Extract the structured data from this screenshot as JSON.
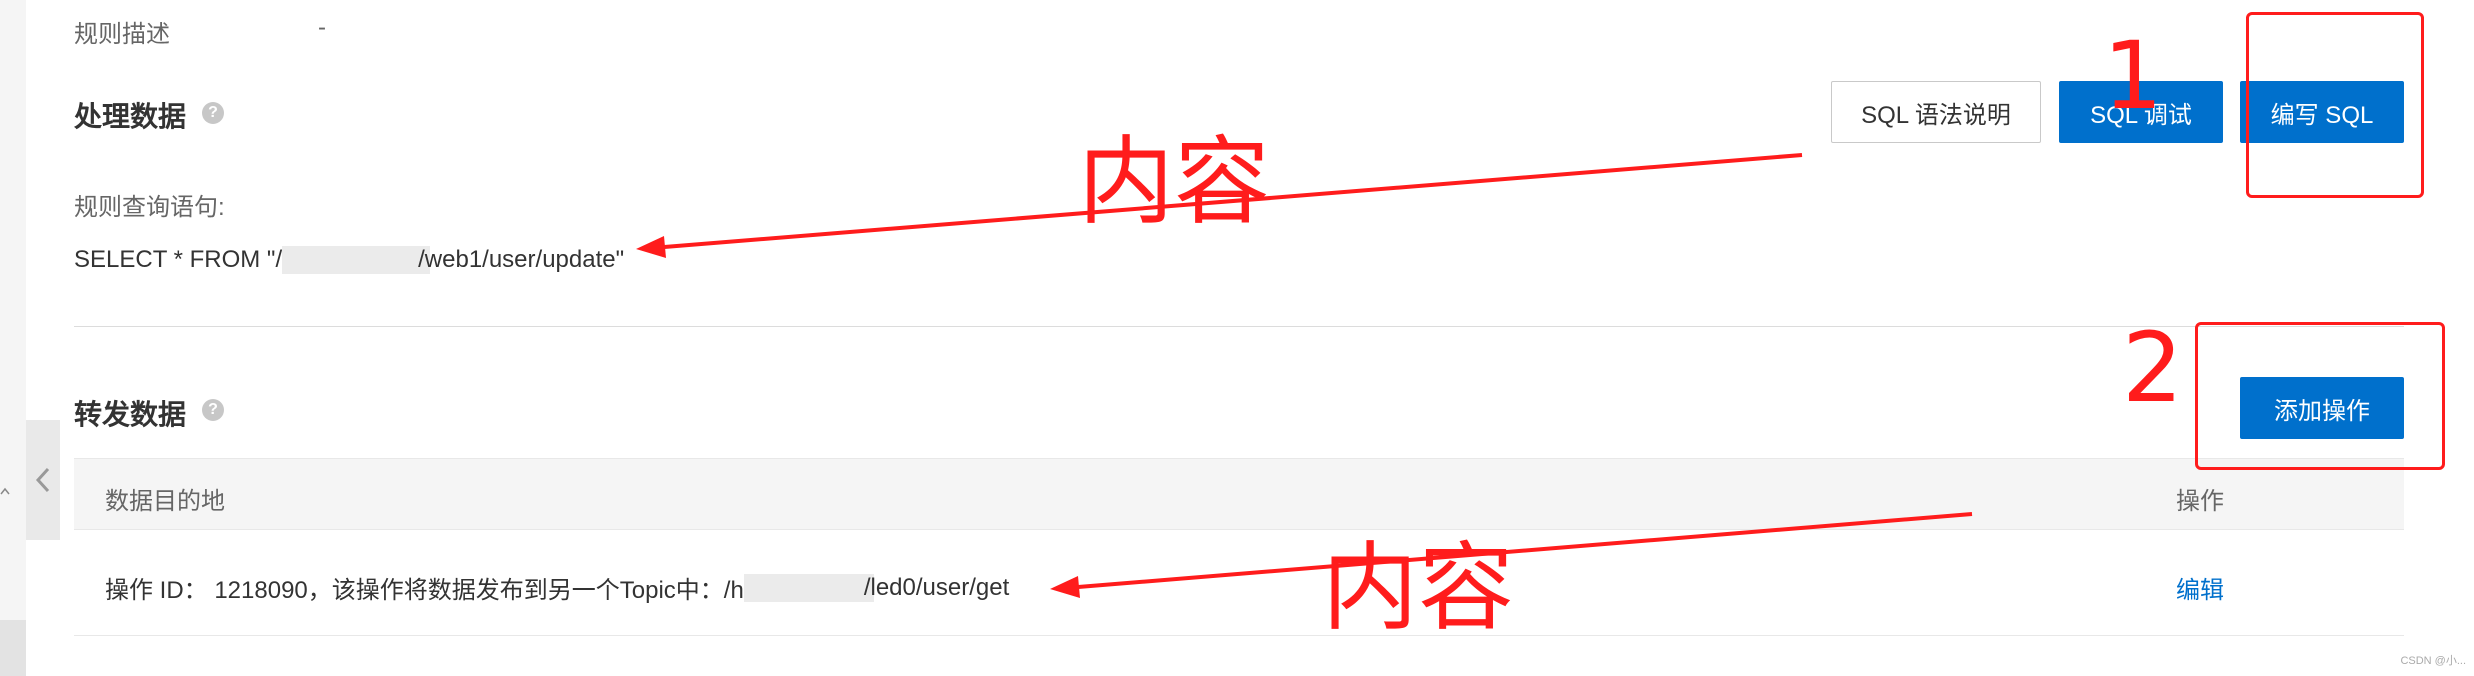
{
  "rule_description": {
    "label": "规则描述",
    "value": "-"
  },
  "process_section": {
    "title": "处理数据",
    "buttons": {
      "sql_syntax": "SQL 语法说明",
      "sql_debug": "SQL 调试",
      "write_sql": "编写 SQL"
    },
    "query_label": "规则查询语句:",
    "query_prefix": "SELECT * FROM \"/",
    "query_suffix": "/web1/user/update\""
  },
  "forward_section": {
    "title": "转发数据",
    "add_button": "添加操作",
    "table": {
      "columns": [
        "数据目的地",
        "操作"
      ],
      "rows": [
        {
          "destination_prefix": "操作 ID： 1218090，该操作将数据发布到另一个Topic中：/h",
          "destination_suffix": "/led0/user/get",
          "action": "编辑"
        }
      ]
    }
  },
  "annotations": {
    "arrow_label_top": "内容",
    "arrow_label_bottom": "内容",
    "box_1_number": "1",
    "box_2_number": "2",
    "color": "#ff1c1c"
  },
  "watermark": "CSDN @小..."
}
